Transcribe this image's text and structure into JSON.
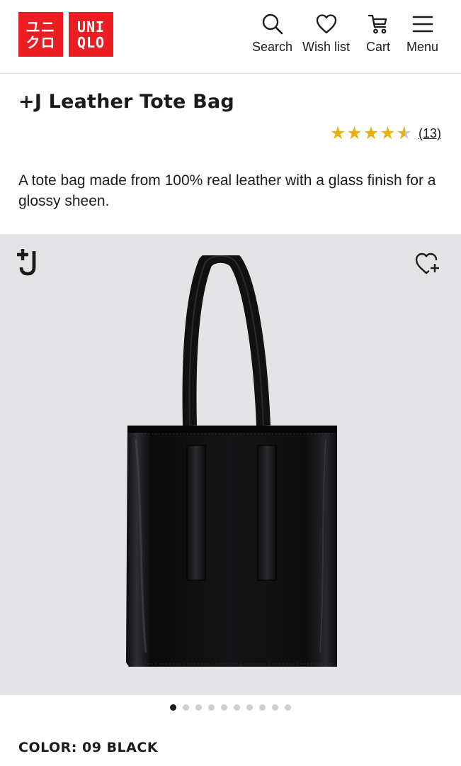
{
  "header": {
    "logo": {
      "line1": "ユニ",
      "line2": "クロ",
      "line3": "UNI",
      "line4": "QLO"
    },
    "nav": [
      {
        "label": "Search",
        "icon": "search-icon"
      },
      {
        "label": "Wish list",
        "icon": "heart-icon"
      },
      {
        "label": "Cart",
        "icon": "cart-icon"
      },
      {
        "label": "Menu",
        "icon": "menu-icon"
      }
    ]
  },
  "product": {
    "title": "+J Leather Tote Bag",
    "rating": 4.5,
    "review_count": "(13)",
    "description": "A tote bag made from 100% real leather with a glass finish for a glossy sheen.",
    "brand_badge": "+J",
    "color_label": "COLOR: 09 BLACK"
  },
  "carousel": {
    "total": 10,
    "active": 1
  },
  "colors": {
    "brand_red": "#ed1d24",
    "star": "#e7b20f",
    "image_bg": "#e4e4e6"
  }
}
